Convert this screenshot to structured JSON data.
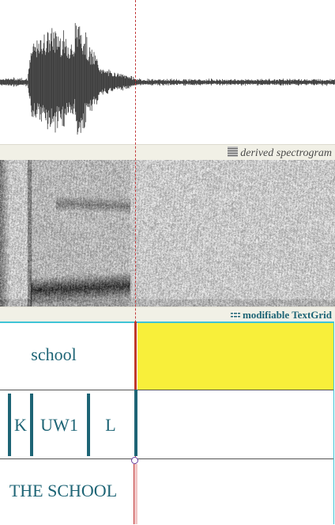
{
  "waveform": {
    "color": "#3a3a3a"
  },
  "spectrogram": {
    "header_label": "derived spectrogram",
    "icon": "spectrogram-icon"
  },
  "textgrid": {
    "header_label": "modifiable TextGrid",
    "icon": "textgrid-icon",
    "frame_color": "#3fc4d6",
    "text_color": "#1d6475",
    "selection_color": "#f8ef3a",
    "tiers": {
      "word": {
        "intervals": [
          {
            "label": "school"
          },
          {
            "label": ""
          }
        ]
      },
      "phone": {
        "intervals": [
          {
            "label": "K"
          },
          {
            "label": "UW1"
          },
          {
            "label": "L"
          },
          {
            "label": ""
          }
        ]
      },
      "phrase": {
        "intervals": [
          {
            "label": "THE SCHOOL"
          }
        ]
      }
    }
  },
  "cursor": {
    "color": "#c23b3b"
  }
}
